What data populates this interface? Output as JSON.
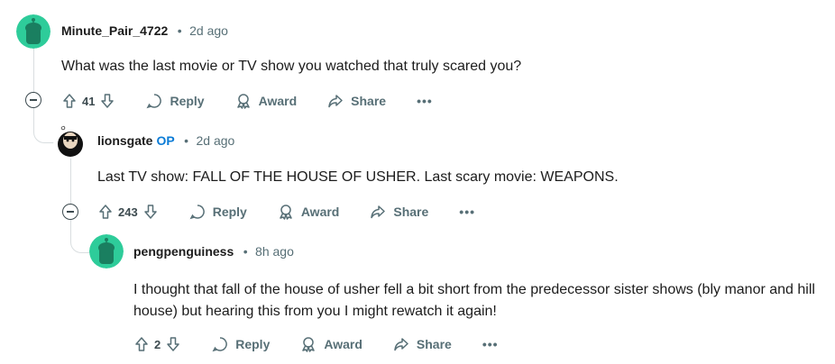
{
  "comments": [
    {
      "username": "Minute_Pair_4722",
      "op": "",
      "time": "2d ago",
      "body": "What was the last movie or TV show you watched that truly scared you?",
      "score": "41",
      "avatar_color": "#2ecc9a"
    },
    {
      "username": "lionsgate",
      "op": "OP",
      "time": "2d ago",
      "body": "Last TV show: FALL OF THE HOUSE OF USHER. Last scary movie: WEAPONS.",
      "score": "243",
      "avatar_color": "#111111"
    },
    {
      "username": "pengpenguiness",
      "op": "",
      "time": "8h ago",
      "body": "I thought that fall of the house of usher fell a bit short from the predecessor sister shows (bly manor and hill house) but hearing this from you I might rewatch it again!",
      "score": "2",
      "avatar_color": "#2ecc9a"
    }
  ],
  "actions": {
    "reply": "Reply",
    "award": "Award",
    "share": "Share",
    "more": "•••"
  },
  "colors": {
    "text": "#1c1c1c",
    "meta": "#576f76",
    "op": "#0a7bd6",
    "thread_line": "#d9dee0"
  }
}
